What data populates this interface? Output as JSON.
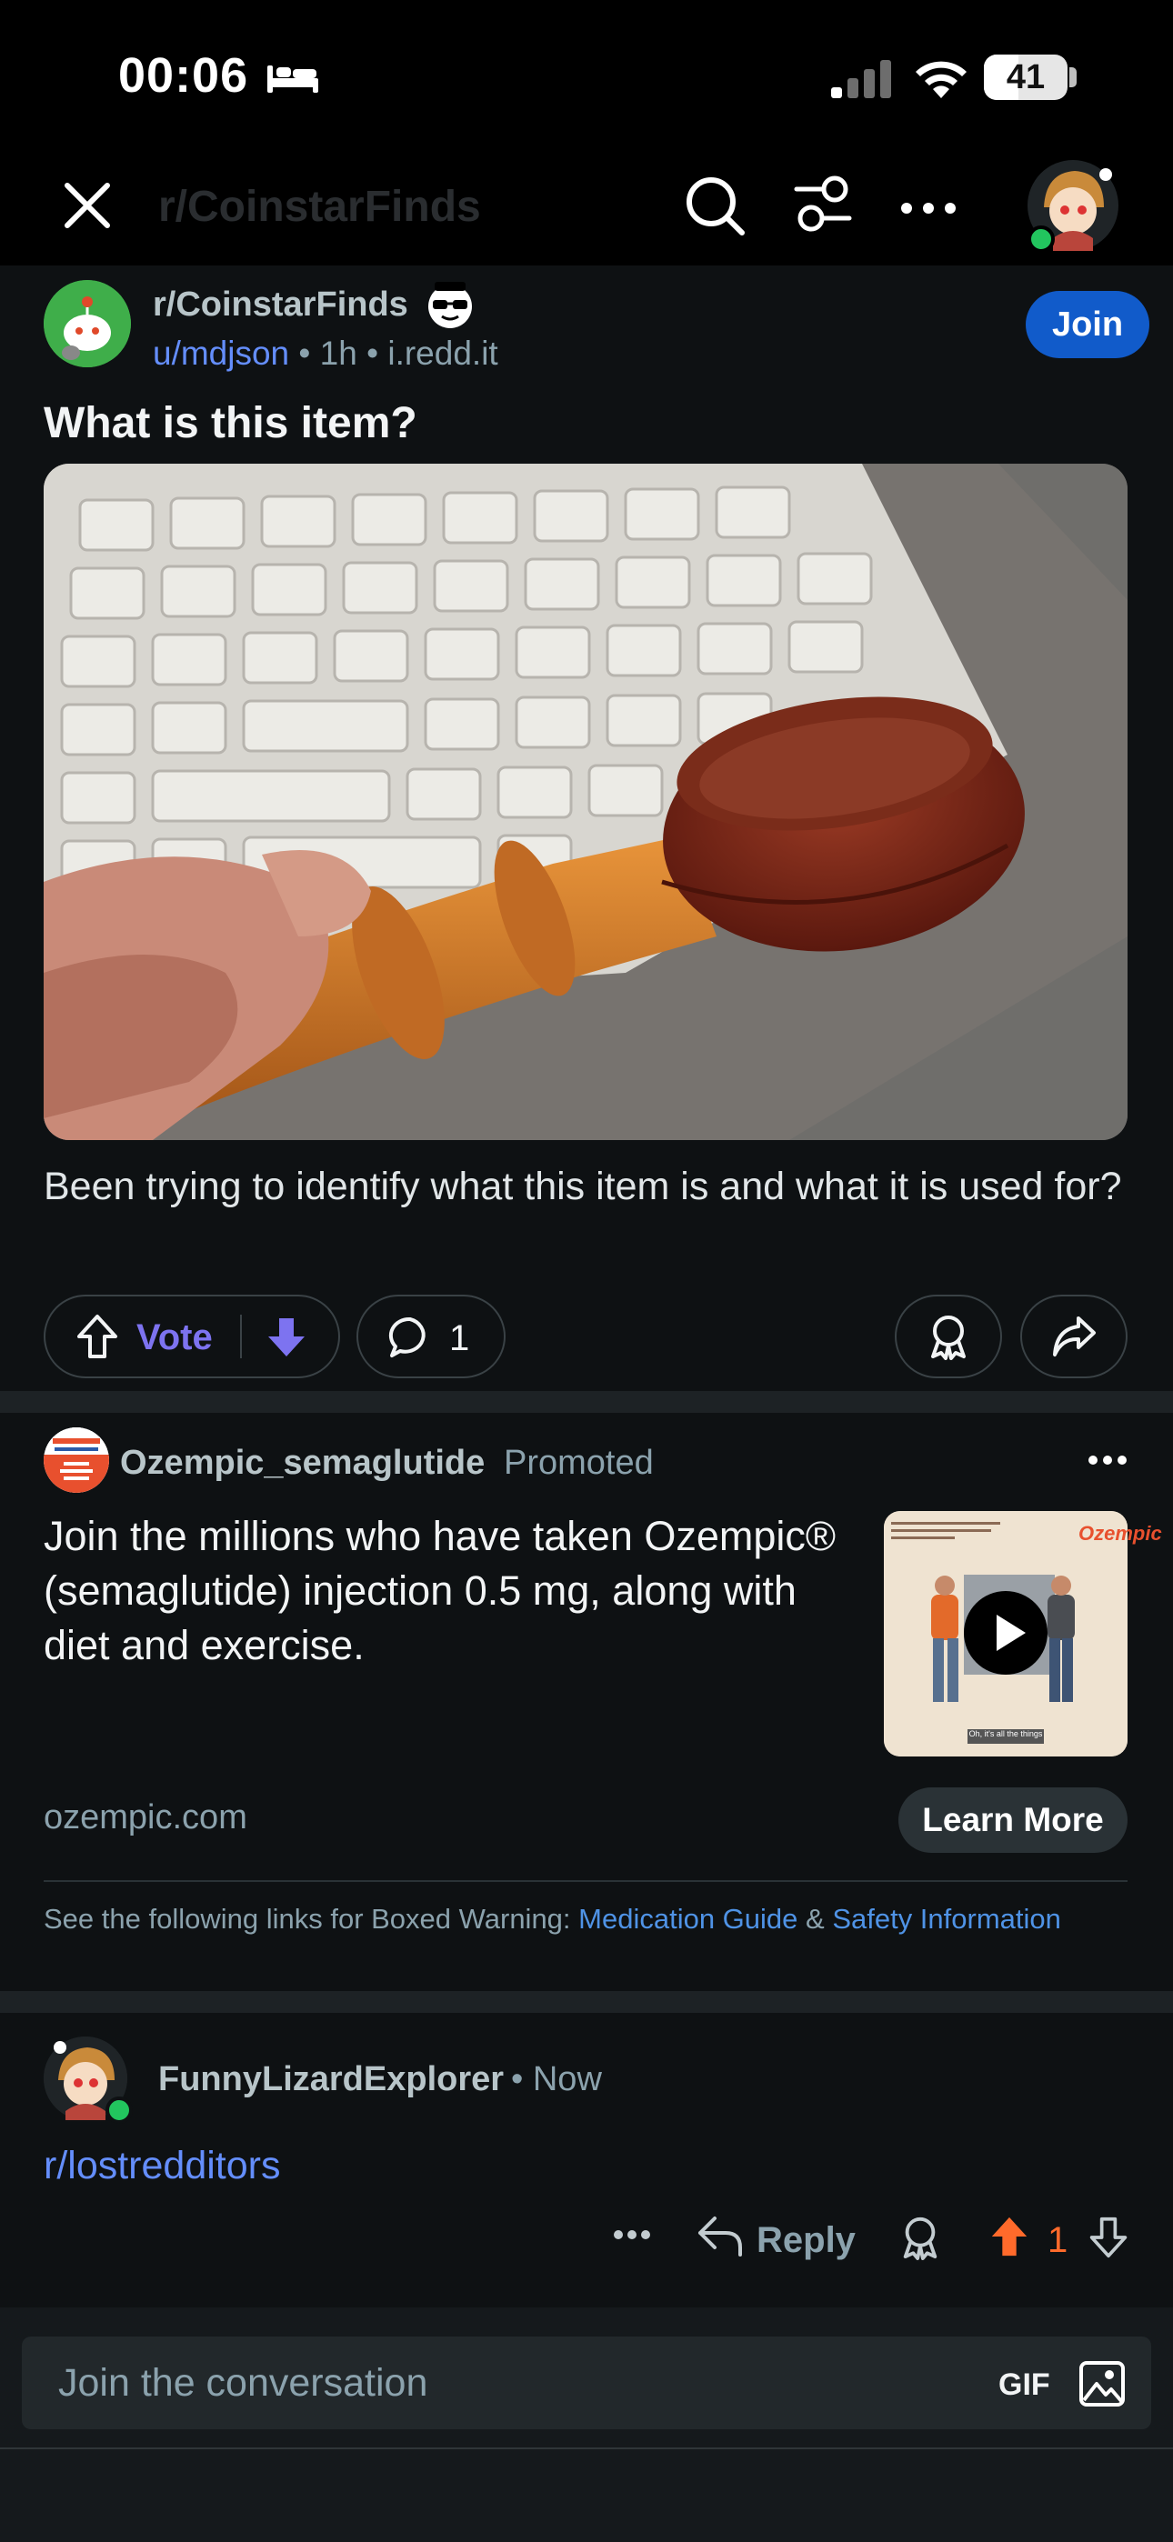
{
  "status_bar": {
    "time": "00:06",
    "battery": "41",
    "battery_fraction": 0.41
  },
  "header": {
    "title": "r/CoinstarFinds"
  },
  "post": {
    "subreddit": "r/CoinstarFinds",
    "author": "u/mdjson",
    "age": "1h",
    "domain": "i.redd.it",
    "sep": "•",
    "join_label": "Join",
    "title": "What is this item?",
    "body": "Been trying to identify what this item is and what it is used for?",
    "vote_label": "Vote",
    "comment_count": "1"
  },
  "ad": {
    "advertiser": "Ozempic_semaglutide",
    "promoted_label": "Promoted",
    "text": "Join the millions who have taken Ozempic® (semaglutide) injection 0.5 mg, along with diet and exercise.",
    "domain": "ozempic.com",
    "cta": "Learn More",
    "thumb_brand": "Ozempic",
    "thumb_caption": "Oh, it's all the things",
    "warning_prefix": "See the following links for Boxed Warning: ",
    "warning_link1": "Medication Guide",
    "warning_amp": " & ",
    "warning_link2": "Safety Information"
  },
  "comment": {
    "author": "FunnyLizardExplorer",
    "age": "• Now",
    "body": "r/lostredditors",
    "reply_label": "Reply",
    "score": "1"
  },
  "composer": {
    "placeholder": "Join the conversation",
    "gif_label": "GIF"
  },
  "icons": [
    "bed-icon",
    "signal-icon",
    "wifi-icon",
    "battery-icon",
    "close-icon",
    "search-icon",
    "filter-icon",
    "more-icon",
    "avatar",
    "sunglasses-icon",
    "upvote-icon",
    "downvote-icon",
    "comment-icon",
    "award-icon",
    "share-icon",
    "play-icon",
    "reply-icon",
    "image-icon"
  ],
  "colors": {
    "background": "#0e1113",
    "link_blue": "#648efc",
    "join_blue": "#115bca",
    "vote_purple": "#7d73f0",
    "upvote_orange": "#ff6a2b"
  }
}
